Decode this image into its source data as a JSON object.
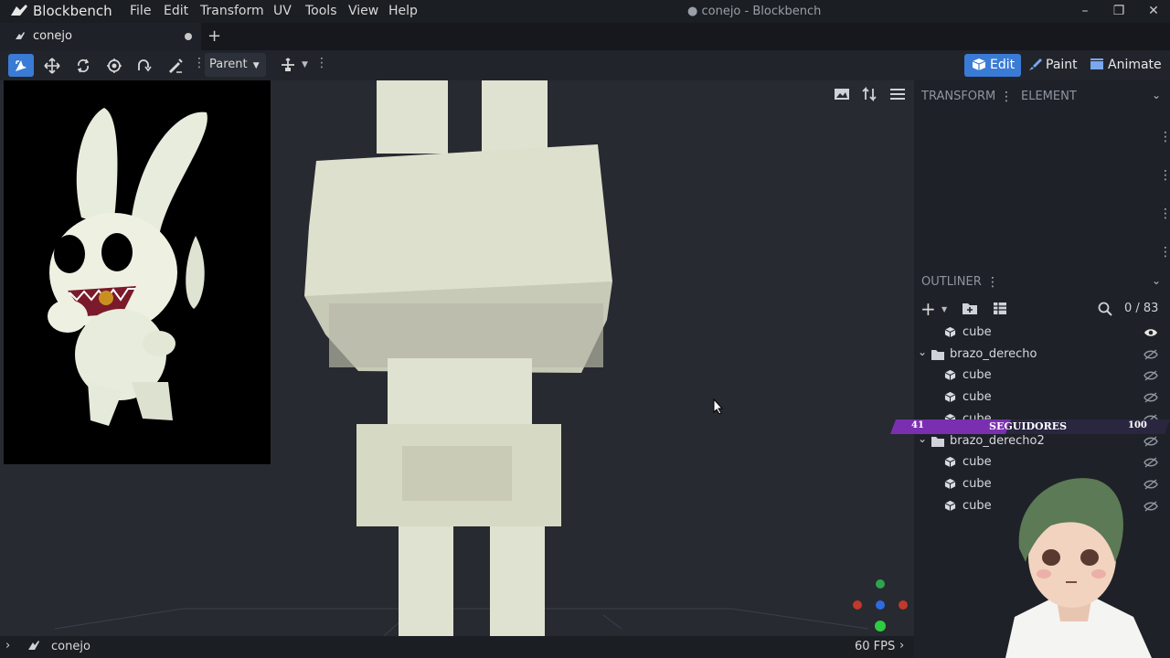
{
  "app": {
    "name": "Blockbench",
    "window_title": "● conejo - Blockbench"
  },
  "menu": [
    "File",
    "Edit",
    "Transform",
    "UV",
    "Tools",
    "View",
    "Help"
  ],
  "tab": {
    "label": "conejo"
  },
  "toolbar": {
    "pivot_mode": "Parent"
  },
  "modes": {
    "edit": "Edit",
    "paint": "Paint",
    "animate": "Animate"
  },
  "panels": {
    "transform": "TRANSFORM",
    "element": "ELEMENT",
    "outliner": "OUTLINER"
  },
  "outliner": {
    "count": "0 / 83",
    "rows": [
      {
        "type": "cube",
        "label": "cube",
        "visible": true
      },
      {
        "type": "group",
        "label": "brazo_derecho",
        "visible": false
      },
      {
        "type": "cube",
        "label": "cube",
        "visible": false
      },
      {
        "type": "cube",
        "label": "cube",
        "visible": false
      },
      {
        "type": "cube",
        "label": "cube",
        "visible": false
      },
      {
        "type": "group",
        "label": "brazo_derecho2",
        "visible": false
      },
      {
        "type": "cube",
        "label": "cube",
        "visible": false
      },
      {
        "type": "cube",
        "label": "cube",
        "visible": false
      },
      {
        "type": "cube",
        "label": "cube",
        "visible": false
      }
    ]
  },
  "followers": {
    "current": "41",
    "label": "SEGUIDORES",
    "goal": "100"
  },
  "status": {
    "project": "conejo",
    "fps": "60 FPS"
  },
  "colors": {
    "accent": "#3a7bd5",
    "viewport_bg": "#272a30",
    "model_fill": "#dcdfcc"
  }
}
